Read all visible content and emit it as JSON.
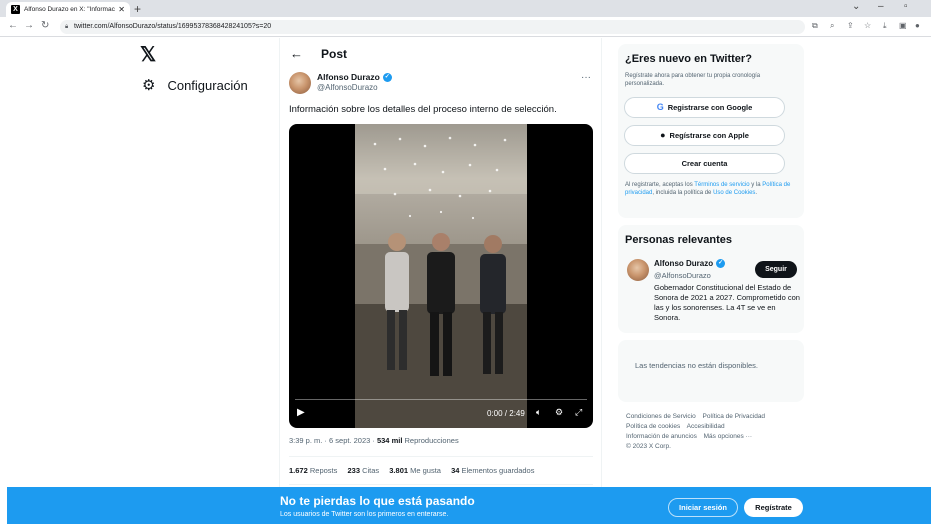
{
  "browser": {
    "tab_title": "Alfonso Durazo en X: \"Informaci",
    "tab_favicon": "X",
    "url": "twitter.com/AlfonsoDurazo/status/1699537836842824105?s=20"
  },
  "nav": {
    "logo": "𝕏",
    "settings_label": "Configuración"
  },
  "post": {
    "header_title": "Post",
    "author_name": "Alfonso Durazo",
    "author_handle": "@AlfonsoDurazo",
    "text": "Información sobre los detalles del proceso interno de selección.",
    "video": {
      "time": "0:00 / 2:49"
    },
    "timestamp": "3:39 p. m. · 6 sept. 2023 · ",
    "views_count": "534 mil",
    "views_label": " Reproducciones",
    "stats": {
      "reposts_count": "1.672",
      "reposts_label": " Reposts",
      "quotes_count": "233",
      "quotes_label": " Citas",
      "likes_count": "3.801",
      "likes_label": " Me gusta",
      "bookmarks_count": "34",
      "bookmarks_label": " Elementos guardados"
    }
  },
  "signup": {
    "title": "¿Eres nuevo en Twitter?",
    "subtitle": "Regístrate ahora para obtener tu propia cronología personalizada.",
    "google_label": "Registrarse con Google",
    "apple_label": "Regístrarse con Apple",
    "create_label": "Crear cuenta",
    "legal_prefix": "Al registrarte, aceptas los ",
    "terms_link": "Términos de servicio",
    "legal_mid": " y la ",
    "privacy_link": "Política de privacidad",
    "legal_mid2": ", incluida la política de ",
    "cookies_link": "Uso de Cookies",
    "legal_end": "."
  },
  "relevant": {
    "title": "Personas relevantes",
    "name": "Alfonso Durazo",
    "handle": "@AlfonsoDurazo",
    "follow_label": "Seguir",
    "bio": "Gobernador Constitucional del Estado de Sonora de 2021 a 2027. Comprometido con las y los sonorenses. La 4T se ve en Sonora."
  },
  "trends": {
    "message": "Las tendencias no están disponibles."
  },
  "footer": {
    "links": [
      "Condiciones de Servicio",
      "Política de Privacidad",
      "Política de cookies",
      "Accesibilidad",
      "Información de anuncios",
      "Más opciones ···"
    ],
    "copyright": "© 2023 X Corp."
  },
  "banner": {
    "headline": "No te pierdas lo que está pasando",
    "subline": "Los usuarios de Twitter son los primeros en enterarse.",
    "login_label": "Iniciar sesión",
    "register_label": "Regístrate"
  },
  "colors": {
    "accent": "#1d9bf0",
    "text": "#0f1419",
    "muted": "#536471"
  }
}
